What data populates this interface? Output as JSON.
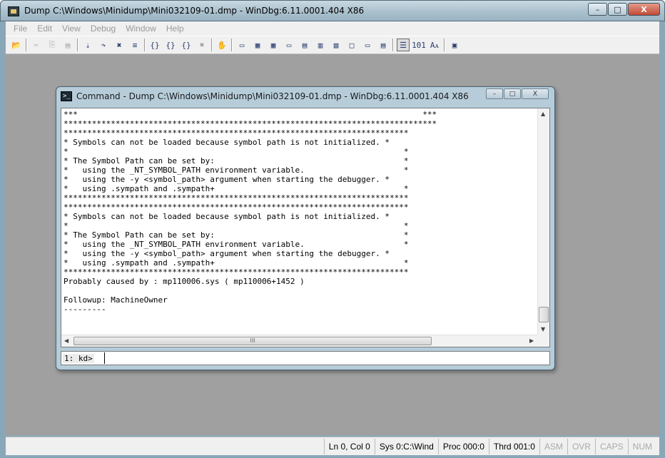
{
  "window": {
    "title": "Dump C:\\Windows\\Minidump\\Mini032109-01.dmp - WinDbg:6.11.0001.404 X86",
    "buttons": {
      "minimize": "–",
      "maximize": "□",
      "close": "X"
    }
  },
  "menu": [
    "File",
    "Edit",
    "View",
    "Debug",
    "Window",
    "Help"
  ],
  "toolbar": {
    "buttons": [
      {
        "name": "open-icon",
        "glyph": "📂",
        "disabled": false
      },
      {
        "name": "cut-icon",
        "glyph": "✂",
        "disabled": true
      },
      {
        "name": "copy-icon",
        "glyph": "⎘",
        "disabled": true
      },
      {
        "name": "paste-icon",
        "glyph": "▤",
        "disabled": true
      },
      {
        "name": "step-into-icon",
        "glyph": "⇣",
        "disabled": false
      },
      {
        "name": "step-over-icon",
        "glyph": "↷",
        "disabled": false
      },
      {
        "name": "breakpoint-icon",
        "glyph": "✖",
        "disabled": false
      },
      {
        "name": "break-icon",
        "glyph": "≡",
        "disabled": false
      },
      {
        "name": "source-mode-icon",
        "glyph": "{}",
        "disabled": false
      },
      {
        "name": "step-out-icon",
        "glyph": "{}",
        "disabled": false
      },
      {
        "name": "run-to-cursor-icon",
        "glyph": "{}",
        "disabled": false
      },
      {
        "name": "stop-icon",
        "glyph": "⏹",
        "disabled": true
      },
      {
        "name": "hand-icon",
        "glyph": "✋",
        "disabled": false
      },
      {
        "name": "command-window-icon",
        "glyph": "▭",
        "disabled": false
      },
      {
        "name": "watch-window-icon",
        "glyph": "▦",
        "disabled": false
      },
      {
        "name": "locals-window-icon",
        "glyph": "▦",
        "disabled": false
      },
      {
        "name": "registers-window-icon",
        "glyph": "▭",
        "disabled": false
      },
      {
        "name": "memory-window-icon",
        "glyph": "▤",
        "disabled": false
      },
      {
        "name": "callstack-window-icon",
        "glyph": "▥",
        "disabled": false
      },
      {
        "name": "disassembly-window-icon",
        "glyph": "▧",
        "disabled": false
      },
      {
        "name": "scratch-pad-icon",
        "glyph": "□",
        "disabled": false
      },
      {
        "name": "processes-window-icon",
        "glyph": "▭",
        "disabled": false
      },
      {
        "name": "source-window-icon",
        "glyph": "▤",
        "disabled": false
      },
      {
        "name": "source-mode-toggle-icon",
        "glyph": "☰",
        "disabled": false,
        "active": true
      },
      {
        "name": "hex-mode-icon",
        "glyph": "101",
        "disabled": false
      },
      {
        "name": "font-icon",
        "glyph": "Aᴀ",
        "disabled": false
      },
      {
        "name": "options-icon",
        "glyph": "▣",
        "disabled": false
      }
    ]
  },
  "command_window": {
    "title": "Command - Dump C:\\Windows\\Minidump\\Mini032109-01.dmp - WinDbg:6.11.0001.404 X86",
    "output": "***                                                                         ***\n*******************************************************************************\n*************************************************************************\n* Symbols can not be loaded because symbol path is not initialized. *\n*                                                                       *\n* The Symbol Path can be set by:                                        *\n*   using the _NT_SYMBOL_PATH environment variable.                     *\n*   using the -y <symbol_path> argument when starting the debugger. *\n*   using .sympath and .sympath+                                        *\n*************************************************************************\n*************************************************************************\n* Symbols can not be loaded because symbol path is not initialized. *\n*                                                                       *\n* The Symbol Path can be set by:                                        *\n*   using the _NT_SYMBOL_PATH environment variable.                     *\n*   using the -y <symbol_path> argument when starting the debugger. *\n*   using .sympath and .sympath+                                        *\n*************************************************************************\nProbably caused by : mp110006.sys ( mp110006+1452 )\n\nFollowup: MachineOwner\n---------",
    "prompt": "1: kd>",
    "input_value": "",
    "hscroll_grip": "III"
  },
  "status": {
    "ln_col": "Ln 0, Col 0",
    "sys": "Sys 0:C:\\Wind",
    "proc": "Proc 000:0",
    "thrd": "Thrd 001:0",
    "asm": "ASM",
    "ovr": "OVR",
    "caps": "CAPS",
    "num": "NUM"
  }
}
